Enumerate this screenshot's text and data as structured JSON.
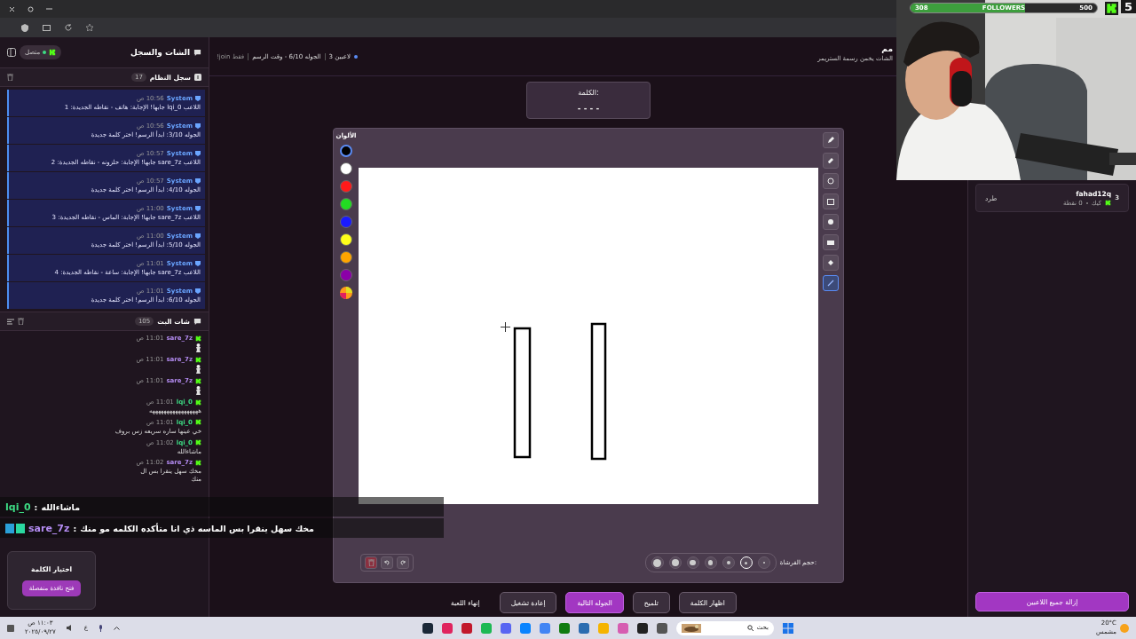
{
  "sidebar": {
    "title": "الشات والسجل",
    "status": "متصل",
    "connected": true,
    "log": {
      "title": "سجل النظام",
      "count": "17",
      "entries": [
        {
          "author": "System",
          "time": "10:56 ص",
          "text": "اللاعب lqi_0 جابها! الإجابة: هاتف - نقاطه الجديدة: 1"
        },
        {
          "author": "System",
          "time": "10:56 ص",
          "text": "الجوله 3/10: ابدأ الرسم! اختر كلمة جديدة"
        },
        {
          "author": "System",
          "time": "10:57 ص",
          "text": "اللاعب sare_7z جابها! الإجابة: حلزونه - نقاطه الجديدة: 2"
        },
        {
          "author": "System",
          "time": "10:57 ص",
          "text": "الجوله 4/10: ابدأ الرسم! اختر كلمة جديدة"
        },
        {
          "author": "System",
          "time": "11:00 ص",
          "text": "اللاعب sare_7z جابها! الإجابة: الماس - نقاطه الجديدة: 3"
        },
        {
          "author": "System",
          "time": "11:00 ص",
          "text": "الجوله 5/10: ابدأ الرسم! اختر كلمة جديدة"
        },
        {
          "author": "System",
          "time": "11:01 ص",
          "text": "اللاعب sare_7z جابها! الإجابة: ساعة - نقاطه الجديدة: 4"
        },
        {
          "author": "System",
          "time": "11:01 ص",
          "text": "الجوله 6/10: ابدأ الرسم! اختر كلمة جديدة"
        }
      ]
    },
    "chat": {
      "title": "شات البث",
      "count": "105",
      "messages": [
        {
          "user": "sare_7z",
          "time": "11:01 ص",
          "color": "#b48cf2",
          "kind": "sticker"
        },
        {
          "user": "sare_7z",
          "time": "11:01 ص",
          "color": "#b48cf2",
          "kind": "sticker"
        },
        {
          "user": "sare_7z",
          "time": "11:01 ص",
          "color": "#b48cf2",
          "kind": "sticker"
        },
        {
          "user": "lqi_0",
          "time": "11:01 ص",
          "color": "#3ddc84",
          "kind": "text",
          "text": "هههههههههههههههههه"
        },
        {
          "user": "lqi_0",
          "time": "11:01 ص",
          "color": "#3ddc84",
          "kind": "text",
          "text": "خي عينها ساره سريعه زس بروف"
        },
        {
          "user": "lqi_0",
          "time": "11:02 ص",
          "color": "#3ddc84",
          "kind": "text",
          "text": "ماشاءالله"
        },
        {
          "user": "sare_7z",
          "time": "11:02 ص",
          "color": "#b48cf2",
          "kind": "text",
          "text": "مخك سهل ينقرا بس ال\nمنك"
        }
      ]
    }
  },
  "game": {
    "title": "مم",
    "subtitle": "الشات يخمن رسمة الستريمر",
    "players": "3 لاعبين",
    "round": "الجوله 6/10 - وقت الرسم",
    "mode": "!join فقط",
    "word_label": "الكلمة:",
    "word": "- - - -"
  },
  "board": {
    "colors_label": "الألوان",
    "colors": [
      {
        "color": "#000000",
        "selected": true
      },
      {
        "color": "#ffffff",
        "selected": false
      },
      {
        "color": "#ff1a1a",
        "selected": false
      },
      {
        "color": "#22dd22",
        "selected": false
      },
      {
        "color": "#1a1aff",
        "selected": false
      },
      {
        "color": "#ffff1a",
        "selected": false
      },
      {
        "color": "#ffa500",
        "selected": false
      },
      {
        "color": "#8b00a8",
        "selected": false
      }
    ],
    "tools": [
      {
        "kind": "pencil",
        "selected": false
      },
      {
        "kind": "eraser",
        "selected": false
      },
      {
        "kind": "circle",
        "selected": false
      },
      {
        "kind": "rect",
        "selected": false
      },
      {
        "kind": "dot",
        "selected": false
      },
      {
        "kind": "bar",
        "selected": false
      },
      {
        "kind": "bucket",
        "selected": false
      },
      {
        "kind": "line",
        "selected": true
      }
    ],
    "brush_label": "حجم الفرشاة:",
    "brush_sizes": [
      {
        "selected": false
      },
      {
        "selected": false
      },
      {
        "selected": false
      },
      {
        "selected": false
      },
      {
        "selected": false
      },
      {
        "selected": true
      },
      {
        "selected": false
      }
    ]
  },
  "actions": [
    {
      "label": "اظهار الكلمة",
      "kind": "outline"
    },
    {
      "label": "تلميح",
      "kind": "outline"
    },
    {
      "label": "الجوله التالية",
      "kind": "primary"
    },
    {
      "label": "إعادة تشغيل",
      "kind": "outline"
    },
    {
      "label": "إنهاء اللعبة",
      "kind": "text"
    }
  ],
  "players": {
    "remove_all": "إزالة جميع اللاعبين",
    "list": [
      {
        "rank": "3",
        "name": "fahad12q",
        "platform": "كيك",
        "points": "0 نقطة",
        "kick": "طرد"
      }
    ]
  },
  "stream": {
    "followers": "308",
    "label": "FOLLOWERS",
    "goal": "500",
    "level": 0.616,
    "count": "5"
  },
  "overlay_chat": [
    {
      "user": "lqi_0",
      "sep": ":",
      "text": "ماشاءالله",
      "color": "#3ddc84"
    },
    {
      "user": "sare_7z",
      "sep": ":",
      "text": "مخك سهل ينقرا بس الماسه ذي انا متأكده الكلمه مو منك",
      "color": "#b48cf2"
    }
  ],
  "word_picker": {
    "title": "اختيار الكلمة",
    "button": "فتح نافذة منفصلة"
  },
  "taskbar": {
    "temp": "20°C",
    "condition": "مشمس",
    "search": "بحث",
    "time": "١١:٠٣ ص",
    "date": "٢٠٢٥/٠٩/٢٧",
    "lang": "ع"
  }
}
